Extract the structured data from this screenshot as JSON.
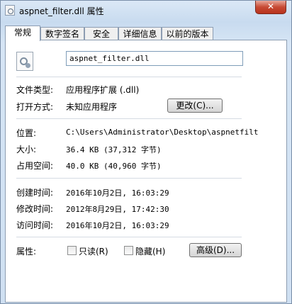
{
  "window": {
    "title": "aspnet_filter.dll 属性",
    "close": "✕"
  },
  "tabs": [
    "常规",
    "数字签名",
    "安全",
    "详细信息",
    "以前的版本"
  ],
  "file": {
    "name": "aspnet_filter.dll"
  },
  "props": {
    "type_label": "文件类型:",
    "type_value": "应用程序扩展 (.dll)",
    "open_label": "打开方式:",
    "open_value": "未知应用程序",
    "change_button": "更改(C)...",
    "location_label": "位置:",
    "location_value": "C:\\Users\\Administrator\\Desktop\\aspnetfilt",
    "size_label": "大小:",
    "size_value": "36.4 KB (37,312 字节)",
    "disk_label": "占用空间:",
    "disk_value": "40.0 KB (40,960 字节)",
    "created_label": "创建时间:",
    "created_value": "2016年10月2日, 16:03:29",
    "modified_label": "修改时间:",
    "modified_value": "2012年8月29日, 17:42:30",
    "accessed_label": "访问时间:",
    "accessed_value": "2016年10月2日, 16:03:29",
    "attr_label": "属性:",
    "readonly_label": "只读(R)",
    "hidden_label": "隐藏(H)",
    "advanced_button": "高级(D)..."
  }
}
